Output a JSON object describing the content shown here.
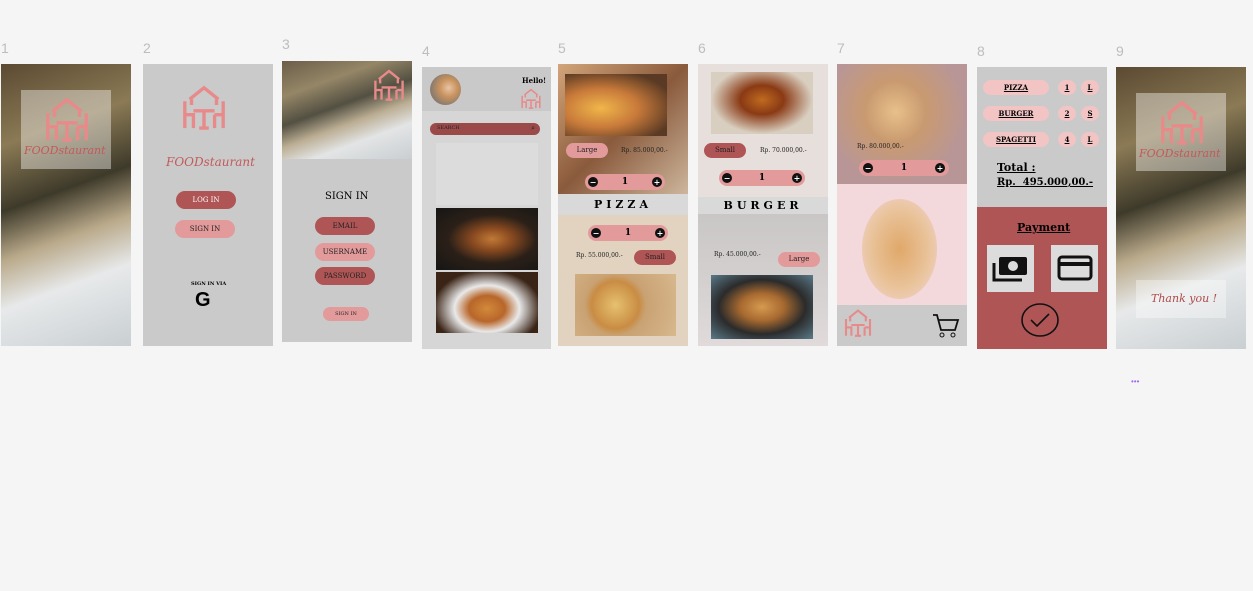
{
  "frame_labels": [
    "1",
    "2",
    "3",
    "4",
    "5",
    "6",
    "7",
    "8",
    "9"
  ],
  "brand": "FOODstaurant",
  "colors": {
    "accent": "#b05555",
    "accent_light": "#e39a9a",
    "canvas": "#f5f5f5",
    "frame": "#cacaca"
  },
  "frame2": {
    "login": "LOG IN",
    "signin": "SIGN IN",
    "sign_in_via": "SIGN IN VIA",
    "google_icon": "G"
  },
  "frame3": {
    "title": "SIGN IN",
    "email": "EMAIL",
    "username": "USERNAME",
    "password": "PASSWORD",
    "submit": "SIGN IN"
  },
  "frame4": {
    "greeting": "Hello!",
    "search_placeholder": "SEARCH"
  },
  "frame5": {
    "size1": "Large",
    "price1": "Rp. 85.000,00.-",
    "qty1": "1",
    "title": "PIZZA",
    "qty2": "1",
    "price2": "Rp. 55.000,00.-",
    "size2": "Small"
  },
  "frame6": {
    "size1": "Small",
    "price1": "Rp. 70.000,00.-",
    "qty1": "1",
    "title": "BURGER",
    "price2": "Rp. 45.000,00.-",
    "size2": "Large"
  },
  "frame7": {
    "price": "Rp. 80.000,00.-",
    "qty": "1"
  },
  "frame8": {
    "items": [
      {
        "name": "PIZZA",
        "qty": "1",
        "size": "L"
      },
      {
        "name": "BURGER",
        "qty": "2",
        "size": "S"
      },
      {
        "name": "SPAGETTI",
        "qty": "4",
        "size": "L"
      }
    ],
    "total_label": "Total :",
    "total_value": "Rp.  495.000,00.-",
    "payment": "Payment"
  },
  "frame9": {
    "thanks": "Thank you !"
  },
  "more": "•••"
}
